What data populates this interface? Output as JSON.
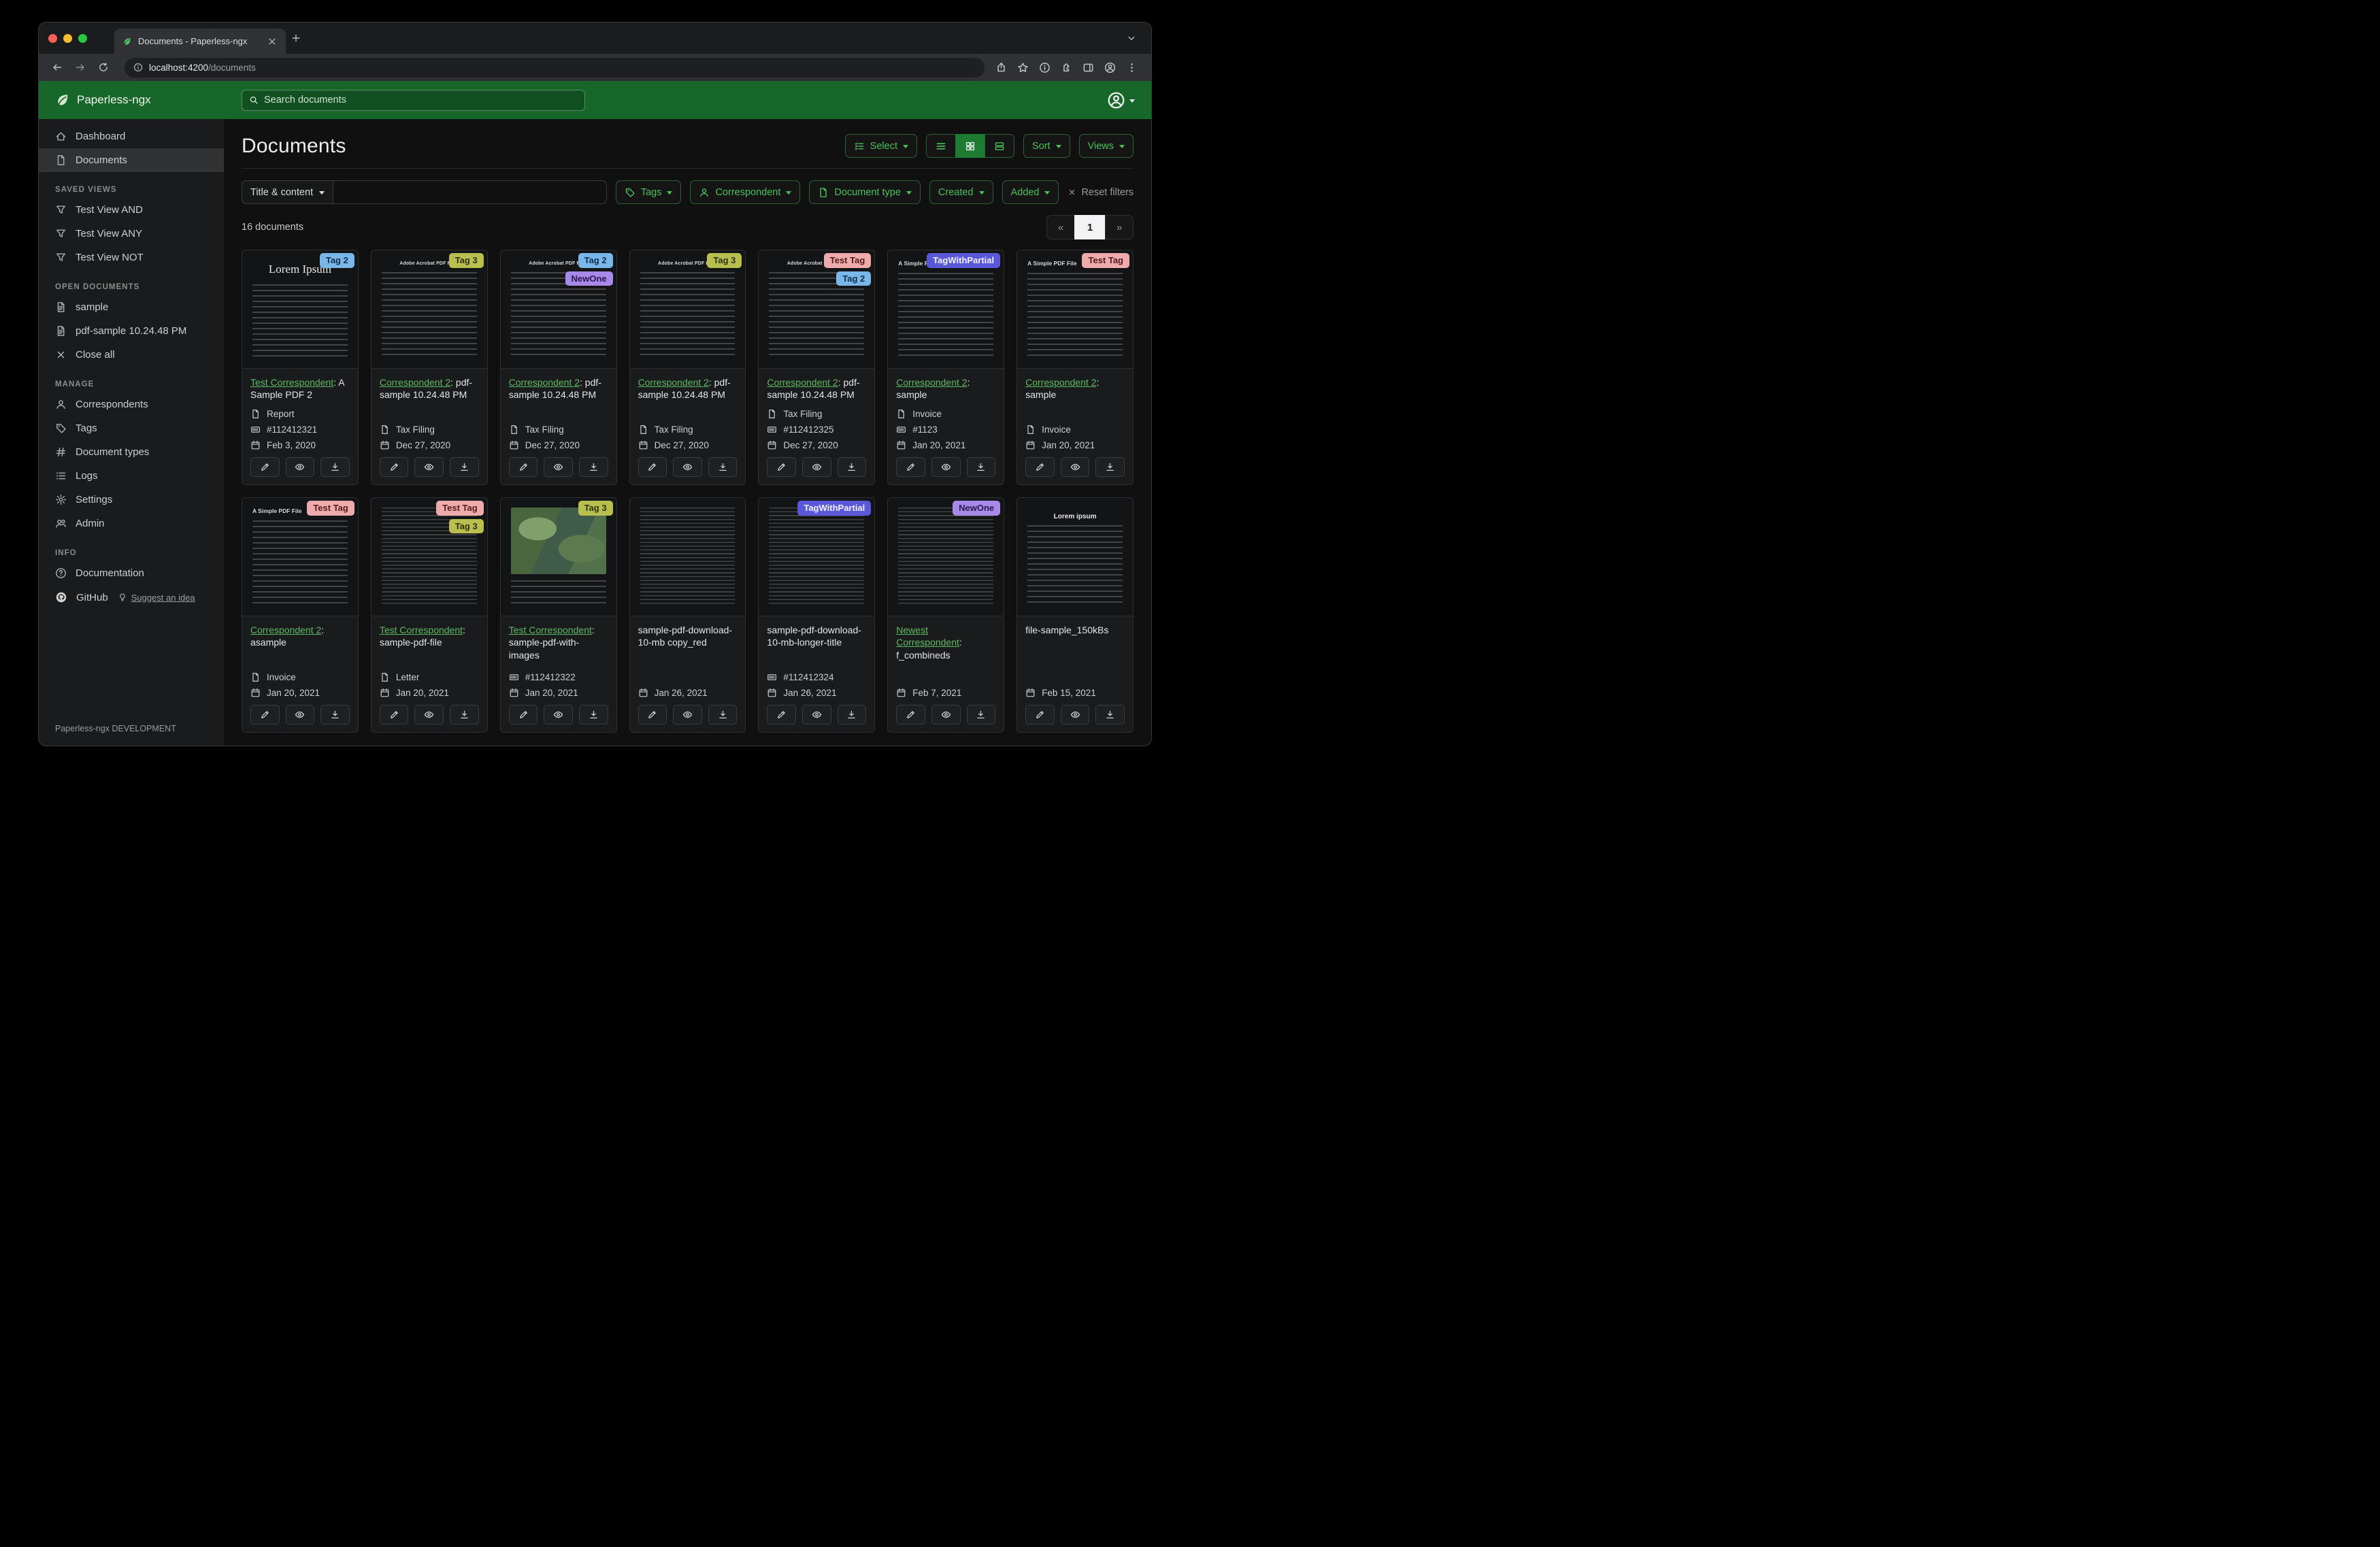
{
  "browser": {
    "tab_title": "Documents - Paperless-ngx",
    "url_host": "localhost:4200",
    "url_path": "/documents"
  },
  "header": {
    "app_name": "Paperless-ngx",
    "search_placeholder": "Search documents"
  },
  "sidebar": {
    "nav": [
      "Dashboard",
      "Documents"
    ],
    "headings": [
      "SAVED VIEWS",
      "OPEN DOCUMENTS",
      "MANAGE",
      "INFO"
    ],
    "saved_views": [
      "Test View AND",
      "Test View ANY",
      "Test View NOT"
    ],
    "open_documents": [
      "sample",
      "pdf-sample 10.24.48 PM"
    ],
    "close_all": "Close all",
    "manage": [
      "Correspondents",
      "Tags",
      "Document types",
      "Logs",
      "Settings",
      "Admin"
    ],
    "info": [
      "Documentation",
      "GitHub"
    ],
    "suggest_link": "Suggest an idea",
    "footer": "Paperless-ngx DEVELOPMENT"
  },
  "toolbar": {
    "title": "Documents",
    "select_label": "Select",
    "sort_label": "Sort",
    "views_label": "Views"
  },
  "filters": {
    "title_dropdown": "Title & content",
    "tags_label": "Tags",
    "correspondent_label": "Correspondent",
    "document_type_label": "Document type",
    "created_label": "Created",
    "added_label": "Added",
    "reset_label": "Reset filters"
  },
  "results": {
    "count_text": "16 documents",
    "prev_label": "«",
    "page_label": "1",
    "next_label": "»"
  },
  "accent_colors": {
    "header_green": "#17672a",
    "button_green": "#49c05a",
    "link_green": "#5cbb61",
    "active_view_green": "#1d7c31"
  },
  "icons": {
    "app_logo": "leaf",
    "search": "magnifier",
    "user_menu": "person-circle",
    "select": "list-check",
    "view_modes": [
      "list",
      "grid",
      "cards"
    ],
    "card_actions": [
      "pencil",
      "eye",
      "download"
    ],
    "meta_rows": [
      "document-type-file",
      "asn-card",
      "calendar"
    ]
  },
  "tag_defs": {
    "Tag 2": {
      "bg": "#79b7e8",
      "fg": "#0f2f4d"
    },
    "Tag 3": {
      "bg": "#b9bf4e",
      "fg": "#2e330e"
    },
    "NewOne": {
      "bg": "#a78ae8",
      "fg": "#2a1650"
    },
    "Test Tag": {
      "bg": "#efaaab",
      "fg": "#511c1c"
    },
    "TagWithPartial": {
      "bg": "#5a58d8",
      "fg": "#f1f1ff"
    }
  },
  "cards": [
    {
      "tags": [
        "Tag 2"
      ],
      "link": "Test Correspondent",
      "rest": ": A Sample PDF 2",
      "type": "Report",
      "asn": "#112412321",
      "date": "Feb 3, 2020",
      "thumb": "lorem-serif",
      "thumb_heading": "Lorem Ipsum"
    },
    {
      "tags": [
        "Tag 3"
      ],
      "link": "Correspondent 2",
      "rest": ": pdf-sample 10.24.48 PM",
      "type": "Tax Filing",
      "date": "Dec 27, 2020",
      "thumb": "adobe",
      "thumb_heading": "Adobe Acrobat PDF Files"
    },
    {
      "tags": [
        "Tag 2",
        "NewOne"
      ],
      "link": "Correspondent 2",
      "rest": ": pdf-sample 10.24.48 PM",
      "type": "Tax Filing",
      "date": "Dec 27, 2020",
      "thumb": "adobe",
      "thumb_heading": "Adobe Acrobat PDF Files"
    },
    {
      "tags": [
        "Tag 3"
      ],
      "link": "Correspondent 2",
      "rest": ": pdf-sample 10.24.48 PM",
      "type": "Tax Filing",
      "date": "Dec 27, 2020",
      "thumb": "adobe",
      "thumb_heading": "Adobe Acrobat PDF Files"
    },
    {
      "tags": [
        "Test Tag",
        "Tag 2"
      ],
      "link": "Correspondent 2",
      "rest": ": pdf-sample 10.24.48 PM",
      "type": "Tax Filing",
      "asn": "#112412325",
      "date": "Dec 27, 2020",
      "thumb": "adobe",
      "thumb_heading": "Adobe Acrobat PDF Files"
    },
    {
      "tags": [
        "TagWithPartial"
      ],
      "link": "Correspondent 2",
      "rest": ": sample",
      "type": "Invoice",
      "asn": "#1123",
      "date": "Jan 20, 2021",
      "thumb": "simple",
      "thumb_heading": "A Simple PDF File"
    },
    {
      "tags": [
        "Test Tag"
      ],
      "link": "Correspondent 2",
      "rest": ": sample",
      "type": "Invoice",
      "date": "Jan 20, 2021",
      "thumb": "simple",
      "thumb_heading": "A Simple PDF File"
    },
    {
      "tags": [
        "Test Tag"
      ],
      "link": "Correspondent 2",
      "rest": ": asample",
      "type": "Invoice",
      "date": "Jan 20, 2021",
      "thumb": "simple",
      "thumb_heading": "A Simple PDF File"
    },
    {
      "tags": [
        "Test Tag",
        "Tag 3"
      ],
      "link": "Test Correspondent",
      "rest": ": sample-pdf-file",
      "type": "Letter",
      "date": "Jan 20, 2021",
      "thumb": "dense"
    },
    {
      "tags": [
        "Tag 3"
      ],
      "link": "Test Correspondent",
      "rest": ": sample-pdf-with-images",
      "asn": "#112412322",
      "date": "Jan 20, 2021",
      "thumb": "map"
    },
    {
      "tags": [],
      "title": "sample-pdf-download-10-mb copy_red",
      "date": "Jan 26, 2021",
      "thumb": "dense"
    },
    {
      "tags": [
        "TagWithPartial"
      ],
      "title": "sample-pdf-download-10-mb-longer-title",
      "asn": "#112412324",
      "date": "Jan 26, 2021",
      "thumb": "dense"
    },
    {
      "tags": [
        "NewOne"
      ],
      "link": "Newest Correspondent",
      "rest": ": f_combineds",
      "date": "Feb 7, 2021",
      "thumb": "dense"
    },
    {
      "tags": [],
      "title": "file-sample_150kBs",
      "date": "Feb 15, 2021",
      "thumb": "lorem-bold",
      "thumb_heading": "Lorem ipsum"
    }
  ]
}
